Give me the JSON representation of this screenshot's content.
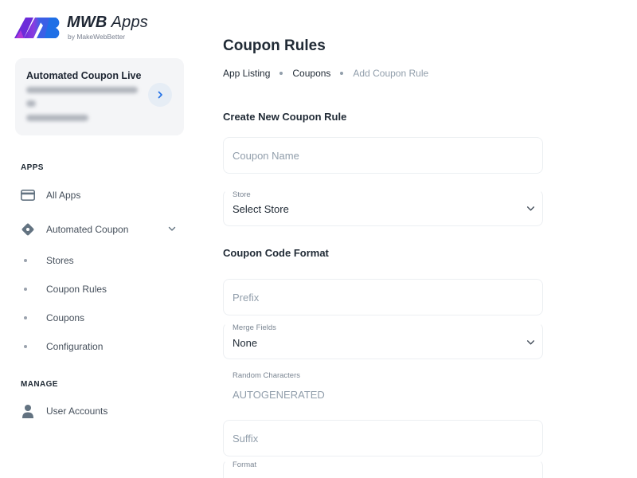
{
  "brand": {
    "title_bold": "MWB",
    "title_rest": " Apps",
    "subtitle": "by MakeWebBetter",
    "colors": {
      "logo_blue": "#1f6fe6",
      "logo_purple": "#6c2bd9",
      "logo_pink": "#c23bd4"
    }
  },
  "account_card": {
    "title": "Automated Coupon Live",
    "arrow_icon": "chevron-right-icon"
  },
  "sidebar": {
    "apps_label": "APPS",
    "manage_label": "MANAGE",
    "items": [
      {
        "label": "All Apps",
        "icon": "credit-card-icon"
      },
      {
        "label": "Automated Coupon",
        "icon": "coupon-tag-icon"
      }
    ],
    "sub_items": [
      {
        "label": "Stores"
      },
      {
        "label": "Coupon Rules"
      },
      {
        "label": "Coupons"
      },
      {
        "label": "Configuration"
      }
    ],
    "manage_items": [
      {
        "label": "User Accounts",
        "icon": "user-icon"
      }
    ]
  },
  "page": {
    "title": "Coupon Rules",
    "breadcrumb": [
      "App Listing",
      "Coupons",
      "Add Coupon Rule"
    ]
  },
  "form": {
    "create_section_title": "Create New Coupon Rule",
    "coupon_name_placeholder": "Coupon Name",
    "store_label": "Store",
    "store_value": "Select Store",
    "format_section_title": "Coupon Code Format",
    "prefix_placeholder": "Prefix",
    "merge_fields_label": "Merge Fields",
    "merge_fields_value": "None",
    "random_chars_label": "Random Characters",
    "random_chars_value": "AUTOGENERATED",
    "suffix_placeholder": "Suffix",
    "format_label": "Format"
  }
}
